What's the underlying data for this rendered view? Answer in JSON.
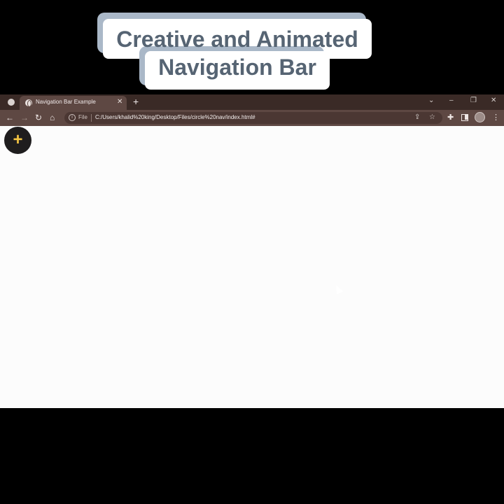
{
  "caption": {
    "line1": "Creative and Animated",
    "line2": "Navigation Bar"
  },
  "browser": {
    "tab": {
      "title": "Navigation Bar Example",
      "favicon": "globe-icon",
      "close_glyph": "✕"
    },
    "new_tab_glyph": "+",
    "window_controls": {
      "dropdown": "⌄",
      "minimize": "–",
      "maximize": "❐",
      "close": "✕"
    },
    "toolbar": {
      "back": "←",
      "forward": "→",
      "reload": "↻",
      "home": "⌂",
      "file_label": "File",
      "url": "C:/Users/khalid%20king/Desktop/Files/circle%20nav/index.html#",
      "share": "⇪",
      "star": "☆",
      "extensions": "✚",
      "menu": "⋮"
    }
  },
  "page": {
    "fab_glyph": "+",
    "fab_color": "#f4c542",
    "fab_bg": "#1f1d1e"
  },
  "colors": {
    "tabbar": "#3a2a26",
    "toolbar": "#5e4843",
    "caption_text": "#566473",
    "caption_shadow": "#aab8c8"
  }
}
